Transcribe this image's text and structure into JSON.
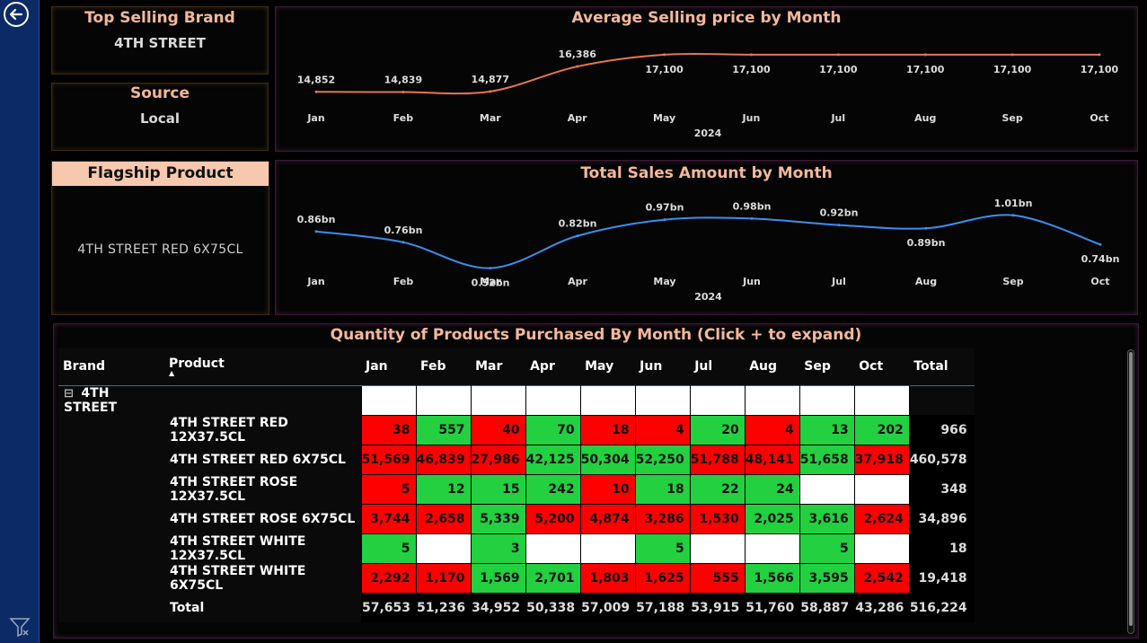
{
  "kpis": {
    "top_brand": {
      "title": "Top Selling Brand",
      "value": "4TH STREET"
    },
    "source": {
      "title": "Source",
      "value": "Local"
    },
    "flagship": {
      "title": "Flagship Product",
      "value": "4TH STREET RED 6X75CL"
    }
  },
  "chart_data": [
    {
      "type": "line",
      "title": "Average Selling price by Month",
      "categories": [
        "Jan",
        "Feb",
        "Mar",
        "Apr",
        "May",
        "Jun",
        "Jul",
        "Aug",
        "Sep",
        "Oct"
      ],
      "values": [
        14852,
        14839,
        14877,
        16386,
        17100,
        17100,
        17100,
        17100,
        17100,
        17100
      ],
      "labels": [
        "14,852",
        "14,839",
        "14,877",
        "16,386",
        "17,100",
        "17,100",
        "17,100",
        "17,100",
        "17,100",
        "17,100"
      ],
      "year_label": "2024",
      "color": "#e8764a"
    },
    {
      "type": "line",
      "title": "Total Sales Amount by Month",
      "categories": [
        "Jan",
        "Feb",
        "Mar",
        "Apr",
        "May",
        "Jun",
        "Jul",
        "Aug",
        "Sep",
        "Oct"
      ],
      "values": [
        0.86,
        0.76,
        0.52,
        0.82,
        0.97,
        0.98,
        0.92,
        0.89,
        1.01,
        0.74
      ],
      "labels": [
        "0.86bn",
        "0.76bn",
        "0.52bn",
        "0.82bn",
        "0.97bn",
        "0.98bn",
        "0.92bn",
        "0.89bn",
        "1.01bn",
        "0.74bn"
      ],
      "year_label": "2024",
      "color": "#3a8ef0"
    }
  ],
  "matrix": {
    "title": "Quantity of Products Purchased By Month (Click + to expand)",
    "columns": [
      "Brand",
      "Product",
      "Jan",
      "Feb",
      "Mar",
      "Apr",
      "May",
      "Jun",
      "Jul",
      "Aug",
      "Sep",
      "Oct",
      "Total"
    ],
    "brand": "4TH STREET",
    "rows": [
      {
        "product": "4TH STREET RED 12X37.5CL",
        "cells": [
          [
            "38",
            "r"
          ],
          [
            "557",
            "g"
          ],
          [
            "40",
            "r"
          ],
          [
            "70",
            "g"
          ],
          [
            "18",
            "r"
          ],
          [
            "4",
            "r"
          ],
          [
            "20",
            "g"
          ],
          [
            "4",
            "r"
          ],
          [
            "13",
            "g"
          ],
          [
            "202",
            "g"
          ]
        ],
        "total": "966"
      },
      {
        "product": "4TH STREET RED 6X75CL",
        "cells": [
          [
            "51,569",
            "r"
          ],
          [
            "46,839",
            "r"
          ],
          [
            "27,986",
            "r"
          ],
          [
            "42,125",
            "g"
          ],
          [
            "50,304",
            "g"
          ],
          [
            "52,250",
            "g"
          ],
          [
            "51,788",
            "r"
          ],
          [
            "48,141",
            "r"
          ],
          [
            "51,658",
            "g"
          ],
          [
            "37,918",
            "r"
          ]
        ],
        "total": "460,578"
      },
      {
        "product": "4TH STREET ROSE 12X37.5CL",
        "cells": [
          [
            "5",
            "r"
          ],
          [
            "12",
            "g"
          ],
          [
            "15",
            "g"
          ],
          [
            "242",
            "g"
          ],
          [
            "10",
            "r"
          ],
          [
            "18",
            "g"
          ],
          [
            "22",
            "g"
          ],
          [
            "24",
            "g"
          ],
          [
            "",
            "w"
          ],
          [
            "",
            "w"
          ]
        ],
        "total": "348"
      },
      {
        "product": "4TH STREET ROSE 6X75CL",
        "cells": [
          [
            "3,744",
            "r"
          ],
          [
            "2,658",
            "r"
          ],
          [
            "5,339",
            "g"
          ],
          [
            "5,200",
            "r"
          ],
          [
            "4,874",
            "r"
          ],
          [
            "3,286",
            "r"
          ],
          [
            "1,530",
            "r"
          ],
          [
            "2,025",
            "g"
          ],
          [
            "3,616",
            "g"
          ],
          [
            "2,624",
            "r"
          ]
        ],
        "total": "34,896"
      },
      {
        "product": "4TH STREET WHITE 12X37.5CL",
        "cells": [
          [
            "5",
            "g"
          ],
          [
            "",
            "w"
          ],
          [
            "3",
            "g"
          ],
          [
            "",
            "w"
          ],
          [
            "",
            "w"
          ],
          [
            "5",
            "g"
          ],
          [
            "",
            "w"
          ],
          [
            "",
            "w"
          ],
          [
            "5",
            "g"
          ],
          [
            "",
            "w"
          ]
        ],
        "total": "18"
      },
      {
        "product": "4TH STREET WHITE 6X75CL",
        "cells": [
          [
            "2,292",
            "r"
          ],
          [
            "1,170",
            "r"
          ],
          [
            "1,569",
            "g"
          ],
          [
            "2,701",
            "g"
          ],
          [
            "1,803",
            "r"
          ],
          [
            "1,625",
            "r"
          ],
          [
            "555",
            "r"
          ],
          [
            "1,566",
            "g"
          ],
          [
            "3,595",
            "g"
          ],
          [
            "2,542",
            "r"
          ]
        ],
        "total": "19,418"
      }
    ],
    "total_row": {
      "label": "Total",
      "values": [
        "57,653",
        "51,236",
        "34,952",
        "50,338",
        "57,009",
        "57,188",
        "53,915",
        "51,760",
        "58,887",
        "43,286"
      ],
      "total": "516,224"
    }
  }
}
